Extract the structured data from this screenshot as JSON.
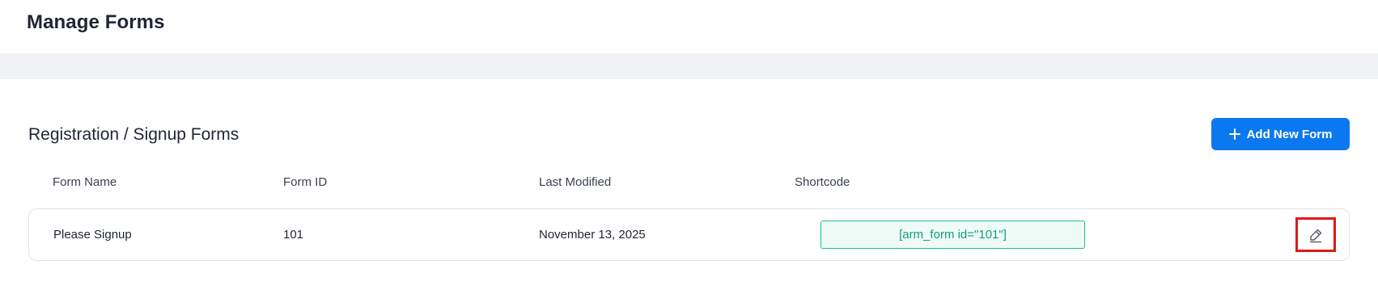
{
  "header": {
    "title": "Manage Forms"
  },
  "section": {
    "title": "Registration / Signup Forms",
    "add_button_label": "Add New Form",
    "add_button_icon": "plus-icon"
  },
  "table": {
    "columns": [
      "Form Name",
      "Form ID",
      "Last Modified",
      "Shortcode"
    ],
    "rows": [
      {
        "form_name": "Please Signup",
        "form_id": "101",
        "last_modified": "November 13, 2025",
        "shortcode": "[arm_form id=\"101\"]",
        "action_icon": "pencil-edit-icon"
      }
    ]
  },
  "colors": {
    "accent": "#0b78f0",
    "shortcode_border": "#1bbf9b",
    "shortcode_bg": "#eefbf7",
    "highlight": "#e11818"
  }
}
